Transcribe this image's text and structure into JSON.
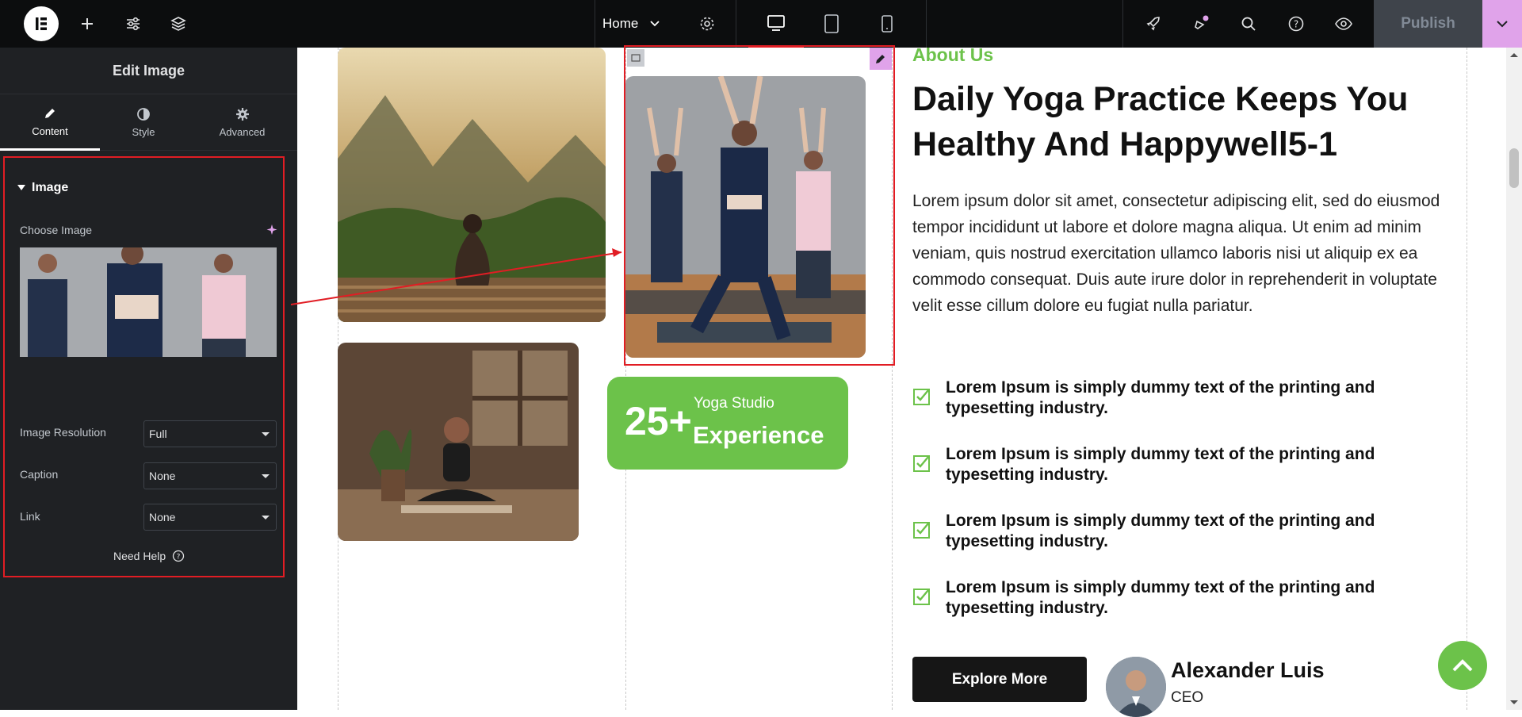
{
  "topbar": {
    "page_name": "Home",
    "publish_label": "Publish",
    "icons": [
      "elementor-logo-icon",
      "add-icon",
      "settings-sliders-icon",
      "layers-icon",
      "page-settings-icon",
      "desktop-icon",
      "tablet-icon",
      "mobile-icon",
      "rocket-icon",
      "notifications-icon",
      "search-icon",
      "help-icon",
      "preview-eye-icon",
      "chevron-down-icon"
    ]
  },
  "panel": {
    "title": "Edit Image",
    "tabs": [
      {
        "label": "Content",
        "active": true
      },
      {
        "label": "Style",
        "active": false
      },
      {
        "label": "Advanced",
        "active": false
      }
    ],
    "section_title": "Image",
    "choose_image_label": "Choose Image",
    "fields": [
      {
        "label": "Image Resolution",
        "value": "Full"
      },
      {
        "label": "Caption",
        "value": "None"
      },
      {
        "label": "Link",
        "value": "None"
      }
    ],
    "need_help": "Need Help"
  },
  "canvas": {
    "badge": {
      "number": "25+",
      "line1": "Yoga Studio",
      "line2": "Experience"
    },
    "about": "About Us",
    "headline": "Daily Yoga Practice Keeps You Healthy And Happywell5-1",
    "paragraph": "Lorem ipsum dolor sit amet, consectetur adipiscing elit, sed do eiusmod tempor incididunt ut labore et dolore magna aliqua. Ut enim ad minim veniam, quis nostrud exercitation ullamco laboris nisi ut aliquip ex ea commodo consequat. Duis aute irure dolor in reprehenderit in voluptate velit esse cillum dolore eu fugiat nulla pariatur.",
    "checklist": [
      "Lorem Ipsum is simply dummy text of the printing and typesetting industry.",
      "Lorem Ipsum is simply dummy text of the printing and typesetting industry.",
      "Lorem Ipsum is simply dummy text of the printing and typesetting industry.",
      "Lorem Ipsum is simply dummy text of the printing and typesetting industry."
    ],
    "explore_label": "Explore More",
    "person": {
      "name": "Alexander Luis",
      "role": "CEO"
    }
  },
  "colors": {
    "accent": "#6cc24a",
    "highlight": "#e11d24",
    "editor_bg": "#1f2124",
    "topbar_bg": "#0c0d0e",
    "pink": "#e0a3ea"
  }
}
